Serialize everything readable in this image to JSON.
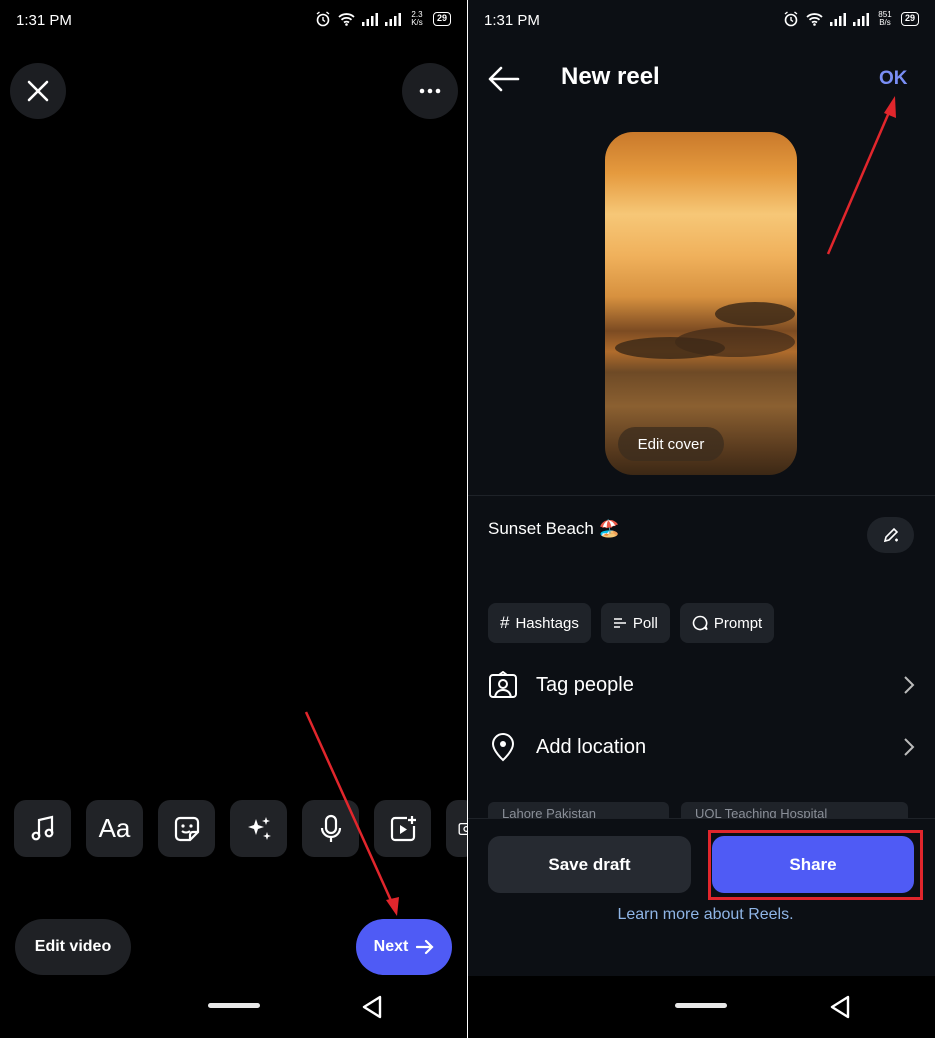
{
  "left": {
    "status": {
      "time": "1:31 PM",
      "netspeed_top": "2.3",
      "netspeed_bottom": "K/s",
      "battery": "29"
    },
    "tools": [
      "music-note-icon",
      "text-icon",
      "sticker-icon",
      "sparkles-icon",
      "microphone-icon",
      "add-clip-icon",
      "camera-icon"
    ],
    "text_tool_label": "Aa",
    "edit_video_label": "Edit video",
    "next_label": "Next"
  },
  "right": {
    "status": {
      "time": "1:31 PM",
      "netspeed_top": "851",
      "netspeed_bottom": "B/s",
      "battery": "29"
    },
    "title": "New reel",
    "ok_label": "OK",
    "edit_cover_label": "Edit cover",
    "caption": "Sunset Beach 🏖️",
    "chips": [
      {
        "icon": "hash-icon",
        "label": "Hashtags"
      },
      {
        "icon": "poll-icon",
        "label": "Poll"
      },
      {
        "icon": "prompt-icon",
        "label": "Prompt"
      }
    ],
    "rows": [
      {
        "icon": "tag-people-icon",
        "label": "Tag people"
      },
      {
        "icon": "location-pin-icon",
        "label": "Add location"
      }
    ],
    "suggestions": [
      "Lahore Pakistan",
      "UOL Teaching Hospital"
    ],
    "save_draft_label": "Save draft",
    "share_label": "Share",
    "learn_more": "Learn more about Reels."
  },
  "colors": {
    "accent": "#4f5bf5",
    "annotation_red": "#e1262c",
    "ok_blue": "#7a8ef5"
  }
}
